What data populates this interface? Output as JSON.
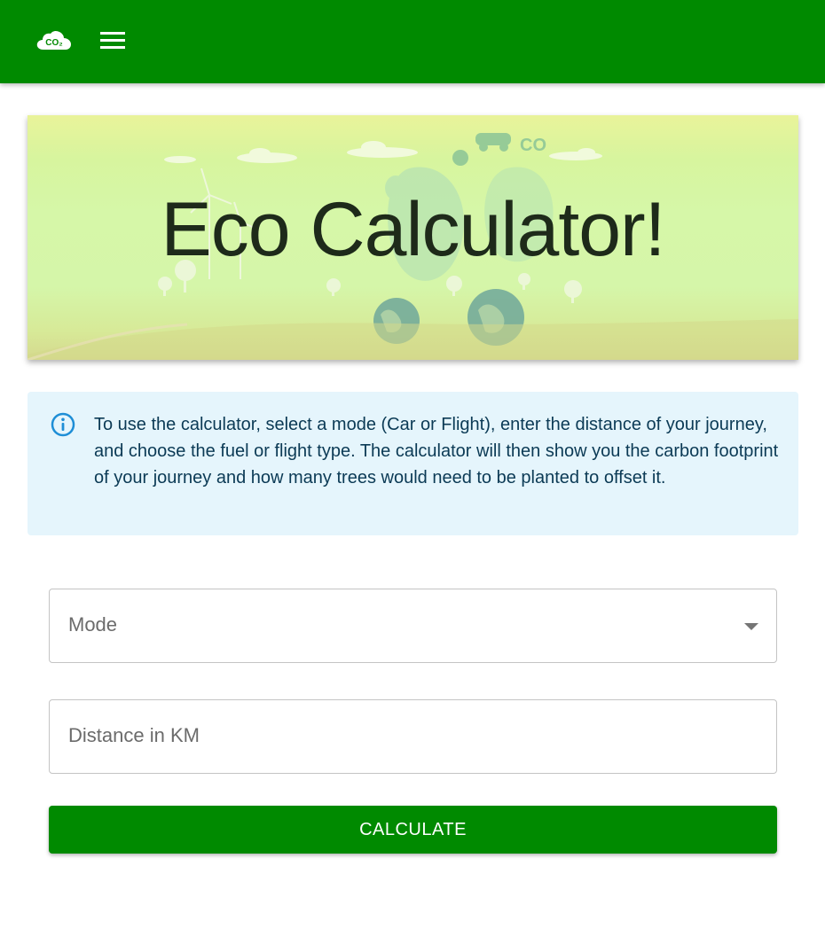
{
  "app": {
    "logo_icon": "co2-cloud-icon",
    "logo_text": "CO₂",
    "menu_icon": "hamburger-menu-icon",
    "brand_color": "#008a00"
  },
  "hero": {
    "title": "Eco Calculator!",
    "background_icon": "eco-footprint-illustration"
  },
  "info": {
    "icon": "info-circle-icon",
    "text": "To use the calculator, select a mode (Car or Flight), enter the distance of your journey, and choose the fuel or flight type. The calculator will then show you the carbon footprint of your journey and how many trees would need to be planted to offset it."
  },
  "form": {
    "mode_label": "Mode",
    "mode_icon": "chevron-down-icon",
    "distance_label": "Distance in KM",
    "calculate_label": "CALCULATE"
  }
}
